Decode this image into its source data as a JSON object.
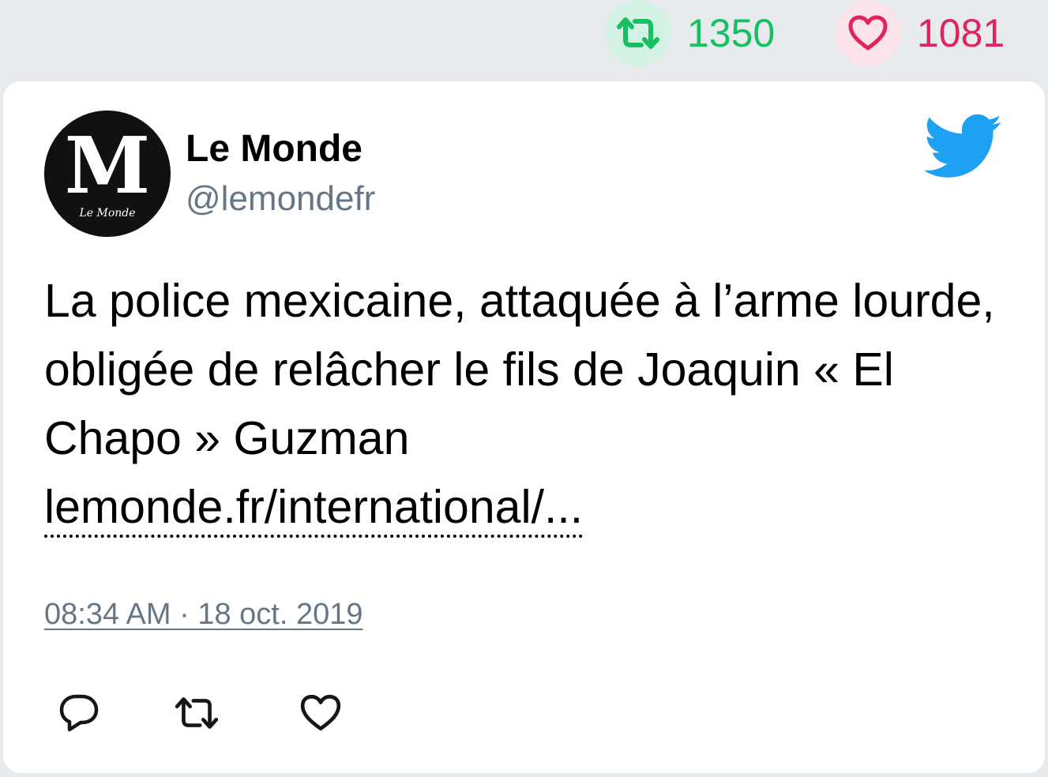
{
  "stats": {
    "retweets": "1350",
    "likes": "1081"
  },
  "author": {
    "name": "Le Monde",
    "handle": "@lemondefr",
    "logo_text": "Le Monde"
  },
  "tweet": {
    "text": "La police mexicaine, attaquée à l’arme lourde, obligée de relâcher le fils de Joaquin « El Chapo » Guzman",
    "link": "lemonde.fr/international/...",
    "timestamp": "08:34 AM · 18 oct. 2019"
  },
  "icons": {
    "retweet_stat": "retweet-icon",
    "like_stat": "heart-icon",
    "brand": "twitter-bird-icon",
    "reply_action": "reply-icon",
    "retweet_action": "retweet-icon",
    "like_action": "heart-icon"
  },
  "colors": {
    "retweet": "#17bf63",
    "like": "#e0245e",
    "twitter_blue": "#1da1f2",
    "secondary_text": "#657786"
  }
}
